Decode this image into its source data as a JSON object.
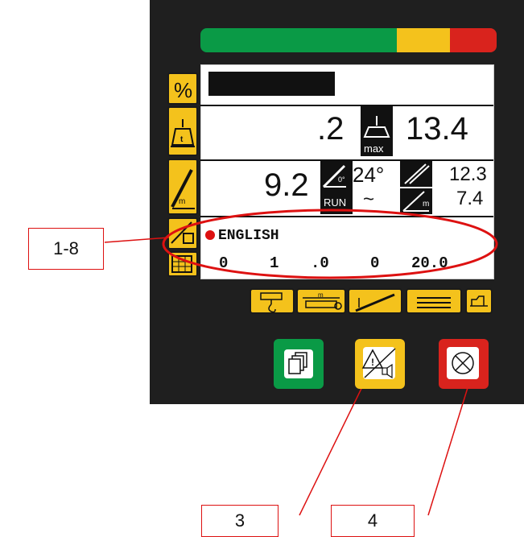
{
  "colors": {
    "green": "#0a9a46",
    "yellow": "#f4c21c",
    "red": "#d9231d",
    "panel": "#1f1f1f",
    "callout": "#dd1111"
  },
  "left_tabs": [
    {
      "icon": "percent-icon",
      "label": "%"
    },
    {
      "icon": "load-weight-icon",
      "label": "t"
    },
    {
      "icon": "boom-length-icon",
      "label": "m"
    },
    {
      "icon": "menu-language-icon",
      "label": ""
    },
    {
      "icon": "grid-icon",
      "label": ""
    }
  ],
  "row2": {
    "value_left": ".2",
    "icon_label": "max",
    "value_right": "13.4"
  },
  "row3": {
    "value_main": "9.2",
    "angle_symbol": "0°",
    "angle": "24°",
    "run_label": "RUN",
    "wave": "~",
    "value_top": "12.3",
    "value_bottom": "7.4",
    "unit_m": "m"
  },
  "menu": {
    "language": "ENGLISH",
    "digits": [
      "0",
      "1",
      ".0",
      "0",
      "20.0"
    ]
  },
  "softkeys": [
    {
      "icon": "hook-icon"
    },
    {
      "icon": "outrigger-width-icon",
      "label": "m"
    },
    {
      "icon": "jib-icon"
    },
    {
      "icon": "stack-icon"
    },
    {
      "icon": "cab-icon"
    }
  ],
  "buttons": [
    {
      "name": "pages-button",
      "color": "#0a9a46"
    },
    {
      "name": "warning-mute-button",
      "color": "#f4c21c"
    },
    {
      "name": "cancel-button",
      "color": "#d9231d"
    }
  ],
  "callouts": {
    "c1": "1-8",
    "c3": "3",
    "c4": "4"
  }
}
